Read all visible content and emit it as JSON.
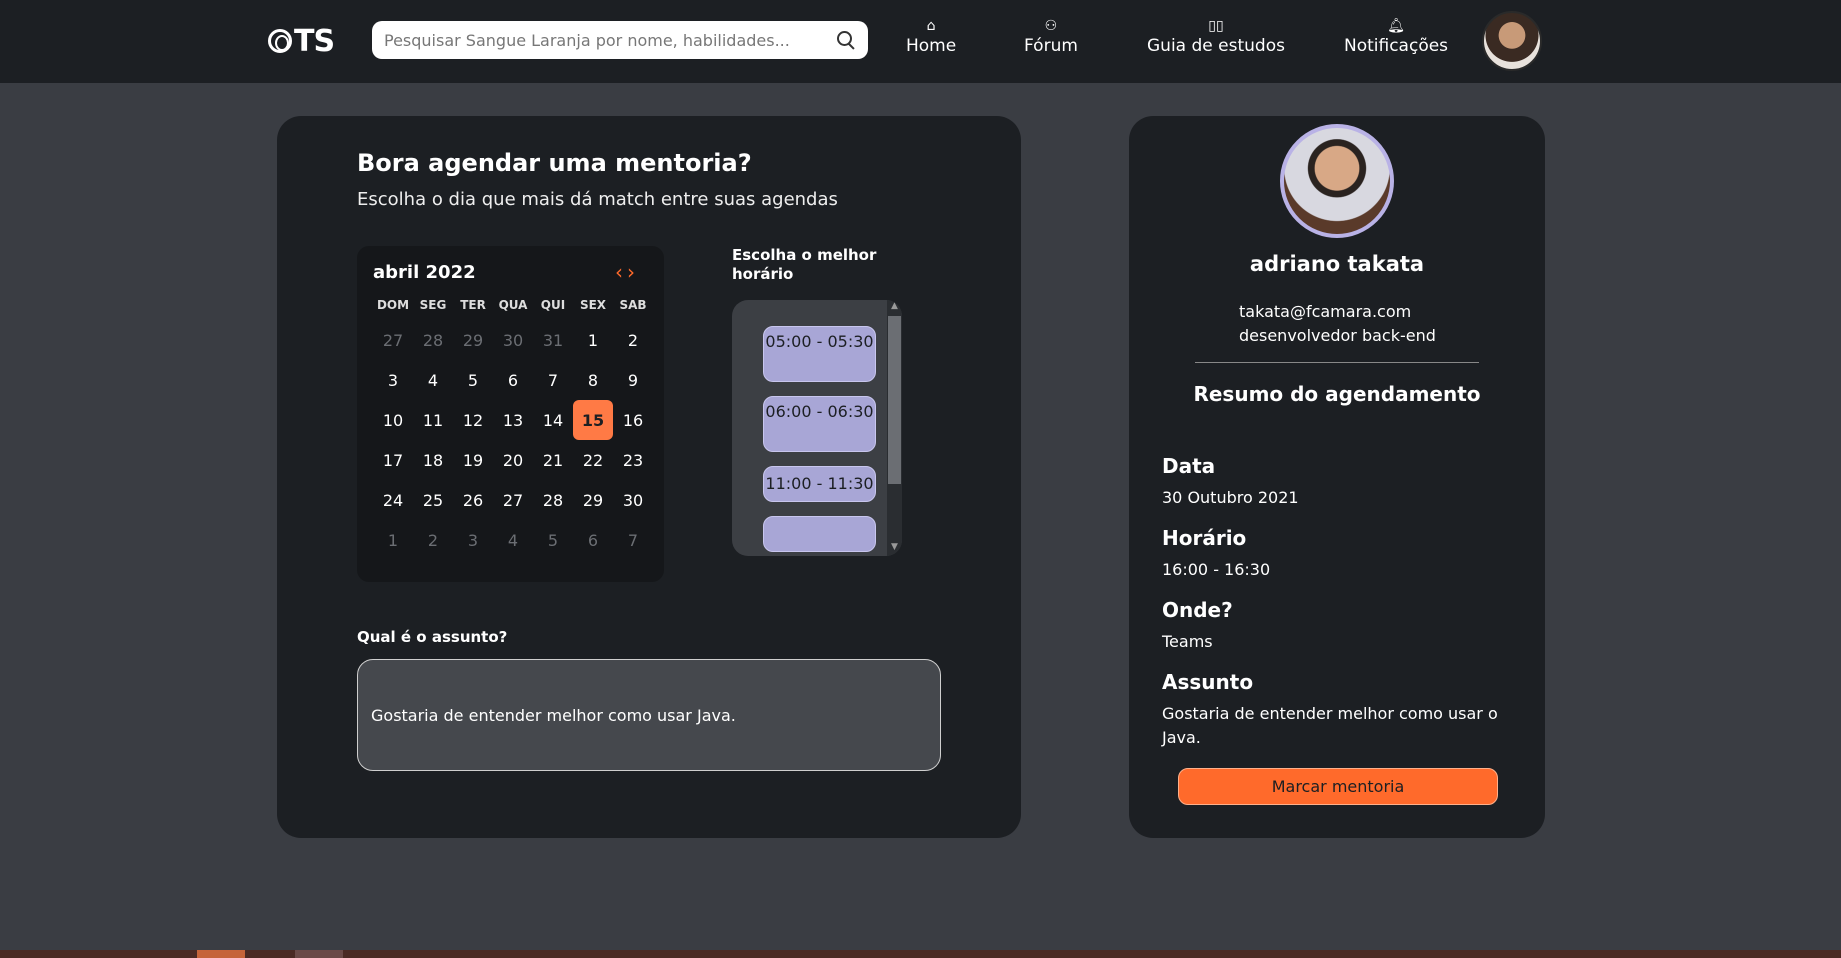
{
  "header": {
    "logo_text": "TS",
    "search_placeholder": "Pesquisar Sangue Laranja por nome, habilidades...",
    "nav": [
      {
        "label": "Home",
        "icon": "home-icon"
      },
      {
        "label": "Fórum",
        "icon": "users-icon"
      },
      {
        "label": "Guia de estudos",
        "icon": "book-icon"
      },
      {
        "label": "Notificações",
        "icon": "bell-icon"
      }
    ]
  },
  "main": {
    "title": "Bora agendar uma mentoria?",
    "subtitle": "Escolha o dia que mais dá match entre suas agendas",
    "calendar": {
      "month": "abril 2022",
      "weekdays": [
        "DOM",
        "SEG",
        "TER",
        "QUA",
        "QUI",
        "SEX",
        "SAB"
      ],
      "days": [
        {
          "d": "27",
          "muted": true
        },
        {
          "d": "28",
          "muted": true
        },
        {
          "d": "29",
          "muted": true
        },
        {
          "d": "30",
          "muted": true
        },
        {
          "d": "31",
          "muted": true
        },
        {
          "d": "1"
        },
        {
          "d": "2"
        },
        {
          "d": "3"
        },
        {
          "d": "4"
        },
        {
          "d": "5"
        },
        {
          "d": "6"
        },
        {
          "d": "7"
        },
        {
          "d": "8"
        },
        {
          "d": "9"
        },
        {
          "d": "10"
        },
        {
          "d": "11"
        },
        {
          "d": "12"
        },
        {
          "d": "13"
        },
        {
          "d": "14"
        },
        {
          "d": "15",
          "selected": true
        },
        {
          "d": "16"
        },
        {
          "d": "17"
        },
        {
          "d": "18"
        },
        {
          "d": "19"
        },
        {
          "d": "20"
        },
        {
          "d": "21"
        },
        {
          "d": "22"
        },
        {
          "d": "23"
        },
        {
          "d": "24"
        },
        {
          "d": "25"
        },
        {
          "d": "26"
        },
        {
          "d": "27"
        },
        {
          "d": "28"
        },
        {
          "d": "29"
        },
        {
          "d": "30"
        },
        {
          "d": "1",
          "muted": true
        },
        {
          "d": "2",
          "muted": true
        },
        {
          "d": "3",
          "muted": true
        },
        {
          "d": "4",
          "muted": true
        },
        {
          "d": "5",
          "muted": true
        },
        {
          "d": "6",
          "muted": true
        },
        {
          "d": "7",
          "muted": true
        }
      ]
    },
    "hours_label": "Escolha o melhor horário",
    "slots": [
      "05:00 - 05:30",
      "06:00 - 06:30",
      "11:00 - 11:30"
    ],
    "subject_label": "Qual é o assunto?",
    "subject_value": "Gostaria de entender melhor como usar Java."
  },
  "side": {
    "name": "adriano takata",
    "email": "takata@fcamara.com",
    "role": "desenvolvedor back-end",
    "summary_title": "Resumo do agendamento",
    "date_label": "Data",
    "date_value": "30 Outubro 2021",
    "time_label": "Horário",
    "time_value": "16:00 - 16:30",
    "where_label": "Onde?",
    "where_value": "Teams",
    "subject_label": "Assunto",
    "subject_value": "Gostaria de entender melhor como usar o Java.",
    "button_label": "Marcar mentoria"
  },
  "colors": {
    "accent": "#ff6a2b",
    "slot": "#a8a6d6",
    "card": "#1c1f23",
    "background": "#3a3d43"
  }
}
